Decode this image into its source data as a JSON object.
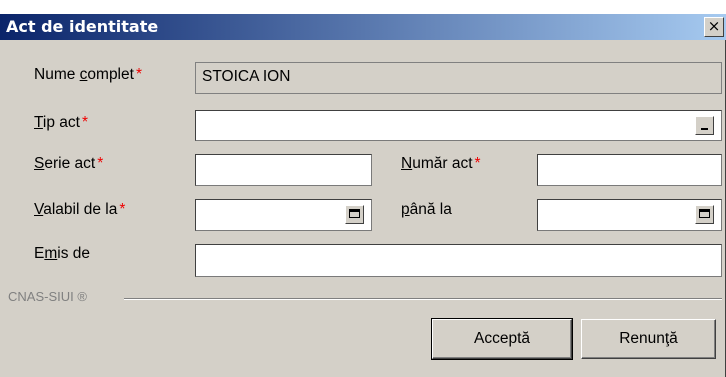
{
  "window": {
    "title": "Act de identitate",
    "close_glyph": "×"
  },
  "form": {
    "nume_complet": {
      "label": "Nume complet",
      "mnemonic": "c",
      "value": "STOICA ION",
      "required": true
    },
    "tip_act": {
      "label": "Tip act",
      "required": true,
      "value": ""
    },
    "serie_act": {
      "label": "Serie act",
      "required": true,
      "value": ""
    },
    "numar_act": {
      "label": "Număr act",
      "required": true,
      "value": ""
    },
    "valabil_de_la": {
      "label": "Valabil de la",
      "required": true,
      "value": ""
    },
    "pana_la": {
      "label": "până la",
      "value": ""
    },
    "emis_de": {
      "label": "Emis de",
      "value": ""
    },
    "required_mark": "*"
  },
  "footer": {
    "brand": "CNAS-SIUI ®"
  },
  "buttons": {
    "accept": "Acceptă",
    "cancel": "Renunţă"
  },
  "colors": {
    "titlebar_start": "#0a246a",
    "titlebar_end": "#a6caf0",
    "dialog_bg": "#d4d0c8",
    "required": "#ee0000"
  }
}
